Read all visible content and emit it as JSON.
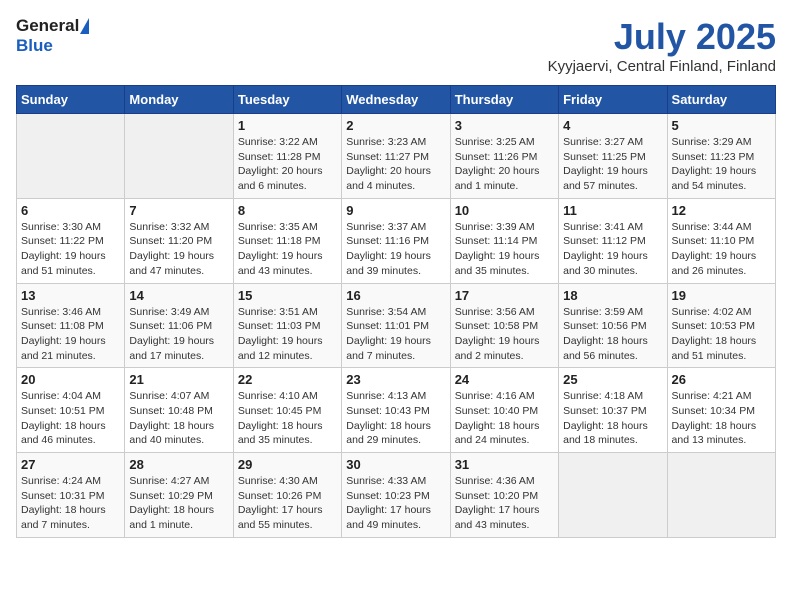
{
  "header": {
    "logo_general": "General",
    "logo_blue": "Blue",
    "title": "July 2025",
    "subtitle": "Kyyjaervi, Central Finland, Finland"
  },
  "weekdays": [
    "Sunday",
    "Monday",
    "Tuesday",
    "Wednesday",
    "Thursday",
    "Friday",
    "Saturday"
  ],
  "weeks": [
    [
      {
        "day": "",
        "detail": ""
      },
      {
        "day": "",
        "detail": ""
      },
      {
        "day": "1",
        "detail": "Sunrise: 3:22 AM\nSunset: 11:28 PM\nDaylight: 20 hours\nand 6 minutes."
      },
      {
        "day": "2",
        "detail": "Sunrise: 3:23 AM\nSunset: 11:27 PM\nDaylight: 20 hours\nand 4 minutes."
      },
      {
        "day": "3",
        "detail": "Sunrise: 3:25 AM\nSunset: 11:26 PM\nDaylight: 20 hours\nand 1 minute."
      },
      {
        "day": "4",
        "detail": "Sunrise: 3:27 AM\nSunset: 11:25 PM\nDaylight: 19 hours\nand 57 minutes."
      },
      {
        "day": "5",
        "detail": "Sunrise: 3:29 AM\nSunset: 11:23 PM\nDaylight: 19 hours\nand 54 minutes."
      }
    ],
    [
      {
        "day": "6",
        "detail": "Sunrise: 3:30 AM\nSunset: 11:22 PM\nDaylight: 19 hours\nand 51 minutes."
      },
      {
        "day": "7",
        "detail": "Sunrise: 3:32 AM\nSunset: 11:20 PM\nDaylight: 19 hours\nand 47 minutes."
      },
      {
        "day": "8",
        "detail": "Sunrise: 3:35 AM\nSunset: 11:18 PM\nDaylight: 19 hours\nand 43 minutes."
      },
      {
        "day": "9",
        "detail": "Sunrise: 3:37 AM\nSunset: 11:16 PM\nDaylight: 19 hours\nand 39 minutes."
      },
      {
        "day": "10",
        "detail": "Sunrise: 3:39 AM\nSunset: 11:14 PM\nDaylight: 19 hours\nand 35 minutes."
      },
      {
        "day": "11",
        "detail": "Sunrise: 3:41 AM\nSunset: 11:12 PM\nDaylight: 19 hours\nand 30 minutes."
      },
      {
        "day": "12",
        "detail": "Sunrise: 3:44 AM\nSunset: 11:10 PM\nDaylight: 19 hours\nand 26 minutes."
      }
    ],
    [
      {
        "day": "13",
        "detail": "Sunrise: 3:46 AM\nSunset: 11:08 PM\nDaylight: 19 hours\nand 21 minutes."
      },
      {
        "day": "14",
        "detail": "Sunrise: 3:49 AM\nSunset: 11:06 PM\nDaylight: 19 hours\nand 17 minutes."
      },
      {
        "day": "15",
        "detail": "Sunrise: 3:51 AM\nSunset: 11:03 PM\nDaylight: 19 hours\nand 12 minutes."
      },
      {
        "day": "16",
        "detail": "Sunrise: 3:54 AM\nSunset: 11:01 PM\nDaylight: 19 hours\nand 7 minutes."
      },
      {
        "day": "17",
        "detail": "Sunrise: 3:56 AM\nSunset: 10:58 PM\nDaylight: 19 hours\nand 2 minutes."
      },
      {
        "day": "18",
        "detail": "Sunrise: 3:59 AM\nSunset: 10:56 PM\nDaylight: 18 hours\nand 56 minutes."
      },
      {
        "day": "19",
        "detail": "Sunrise: 4:02 AM\nSunset: 10:53 PM\nDaylight: 18 hours\nand 51 minutes."
      }
    ],
    [
      {
        "day": "20",
        "detail": "Sunrise: 4:04 AM\nSunset: 10:51 PM\nDaylight: 18 hours\nand 46 minutes."
      },
      {
        "day": "21",
        "detail": "Sunrise: 4:07 AM\nSunset: 10:48 PM\nDaylight: 18 hours\nand 40 minutes."
      },
      {
        "day": "22",
        "detail": "Sunrise: 4:10 AM\nSunset: 10:45 PM\nDaylight: 18 hours\nand 35 minutes."
      },
      {
        "day": "23",
        "detail": "Sunrise: 4:13 AM\nSunset: 10:43 PM\nDaylight: 18 hours\nand 29 minutes."
      },
      {
        "day": "24",
        "detail": "Sunrise: 4:16 AM\nSunset: 10:40 PM\nDaylight: 18 hours\nand 24 minutes."
      },
      {
        "day": "25",
        "detail": "Sunrise: 4:18 AM\nSunset: 10:37 PM\nDaylight: 18 hours\nand 18 minutes."
      },
      {
        "day": "26",
        "detail": "Sunrise: 4:21 AM\nSunset: 10:34 PM\nDaylight: 18 hours\nand 13 minutes."
      }
    ],
    [
      {
        "day": "27",
        "detail": "Sunrise: 4:24 AM\nSunset: 10:31 PM\nDaylight: 18 hours\nand 7 minutes."
      },
      {
        "day": "28",
        "detail": "Sunrise: 4:27 AM\nSunset: 10:29 PM\nDaylight: 18 hours\nand 1 minute."
      },
      {
        "day": "29",
        "detail": "Sunrise: 4:30 AM\nSunset: 10:26 PM\nDaylight: 17 hours\nand 55 minutes."
      },
      {
        "day": "30",
        "detail": "Sunrise: 4:33 AM\nSunset: 10:23 PM\nDaylight: 17 hours\nand 49 minutes."
      },
      {
        "day": "31",
        "detail": "Sunrise: 4:36 AM\nSunset: 10:20 PM\nDaylight: 17 hours\nand 43 minutes."
      },
      {
        "day": "",
        "detail": ""
      },
      {
        "day": "",
        "detail": ""
      }
    ]
  ]
}
